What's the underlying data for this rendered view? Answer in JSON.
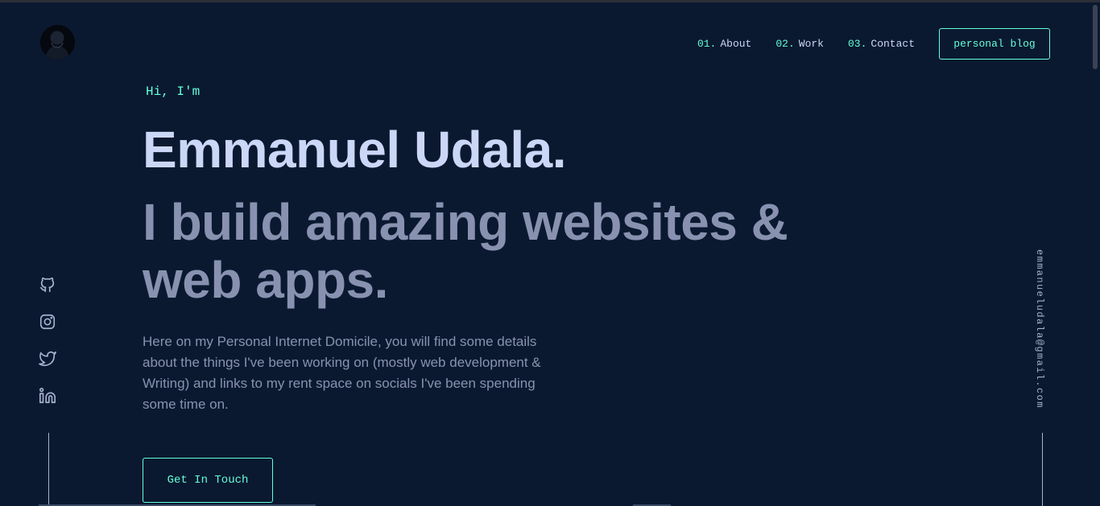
{
  "colors": {
    "background": "#0b1930",
    "accent": "#64ffda",
    "heading": "#ccd6f6",
    "muted": "#8892b0"
  },
  "header": {
    "logo_icon": "avatar-logo",
    "nav": [
      {
        "num": "01.",
        "label": "About"
      },
      {
        "num": "02.",
        "label": "Work"
      },
      {
        "num": "03.",
        "label": "Contact"
      }
    ],
    "blog_button": "personal blog"
  },
  "hero": {
    "greeting": "Hi, I'm",
    "name": "Emmanuel Udala.",
    "tagline": "I build amazing websites & web apps.",
    "intro": "Here on my Personal Internet Domicile, you will find some details about the things I've been working on (mostly web development & Writing) and links to my rent space on socials I've been spending some time on.",
    "cta": "Get In Touch"
  },
  "socials": [
    {
      "icon": "github-icon"
    },
    {
      "icon": "instagram-icon"
    },
    {
      "icon": "twitter-icon"
    },
    {
      "icon": "linkedin-icon"
    }
  ],
  "email": "emmanueludala@gmail.com"
}
